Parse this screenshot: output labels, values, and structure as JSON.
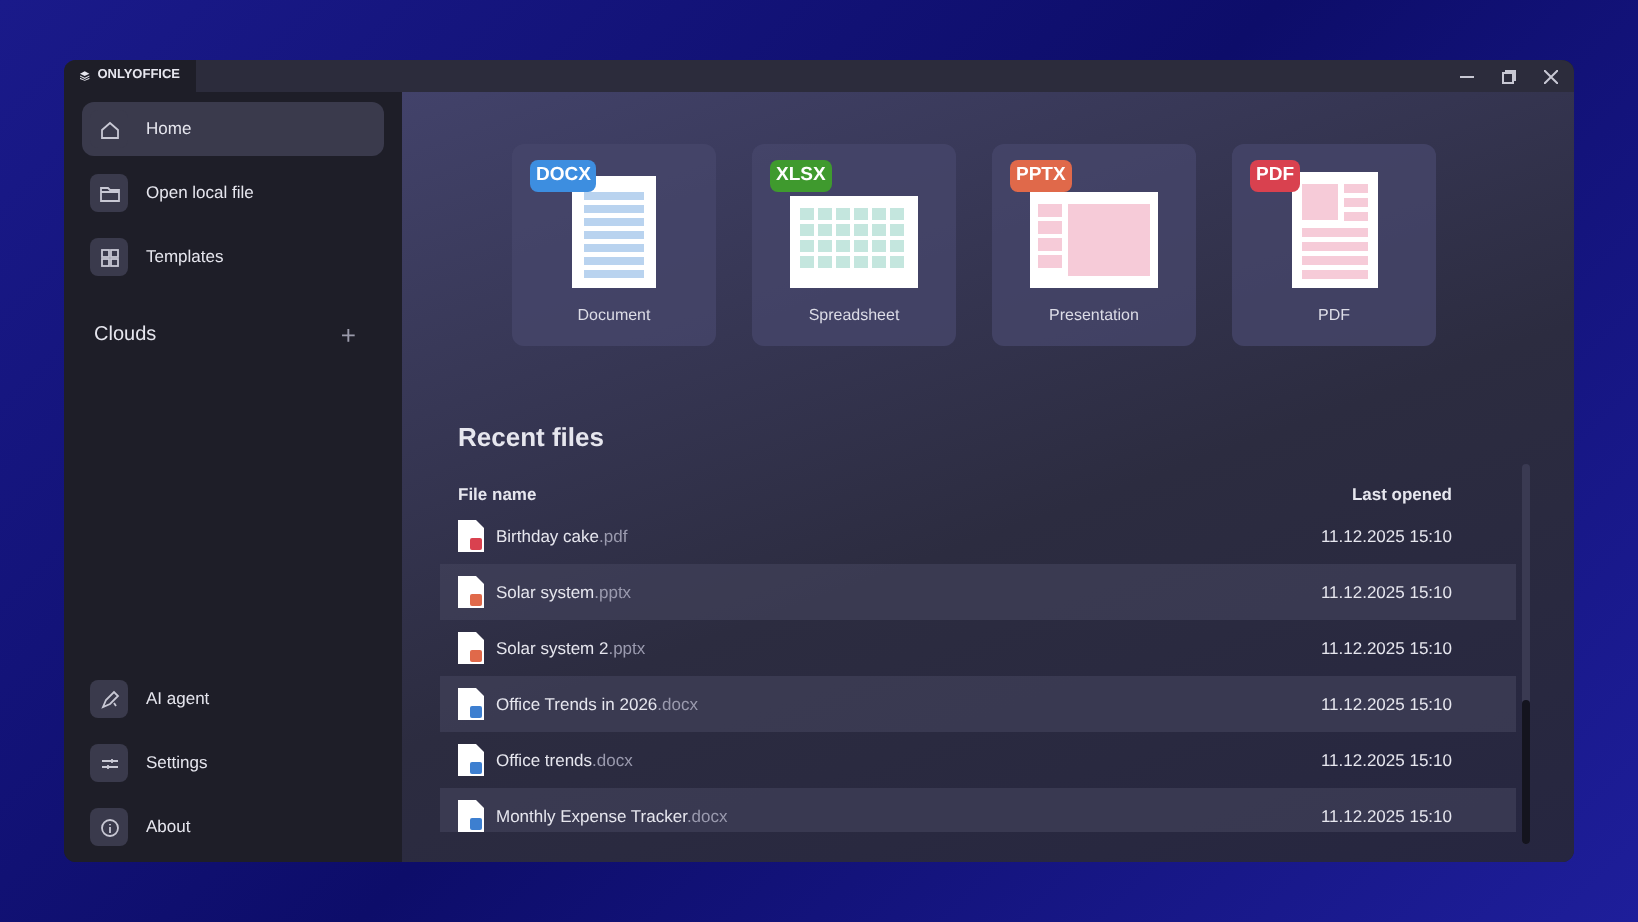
{
  "window": {
    "title": "ONLYOFFICE"
  },
  "sidebar": {
    "items": [
      {
        "label": "Home",
        "selected": true,
        "kind": "home"
      },
      {
        "label": "Open local file",
        "selected": false,
        "kind": "folder"
      },
      {
        "label": "Templates",
        "selected": false,
        "kind": "grid"
      }
    ],
    "clouds": {
      "label": "Clouds",
      "add": "+"
    },
    "bottom_items": [
      {
        "label": "AI agent",
        "kind": "ai"
      },
      {
        "label": "Settings",
        "kind": "settings"
      },
      {
        "label": "About",
        "kind": "info"
      }
    ]
  },
  "create": [
    {
      "kind": "docx",
      "badge": "DOCX",
      "label": "Document"
    },
    {
      "kind": "xlsx",
      "badge": "XLSX",
      "label": "Spreadsheet"
    },
    {
      "kind": "pptx",
      "badge": "PPTX",
      "label": "Presentation"
    },
    {
      "kind": "pdf",
      "badge": "PDF",
      "label": "PDF"
    }
  ],
  "recent": {
    "title": "Recent files",
    "columns": [
      "File name",
      "Last opened"
    ],
    "rows": [
      {
        "kind": "pdf",
        "name": "Birthday cake",
        "ext": ".pdf",
        "opened": "11.12.2025 15:10"
      },
      {
        "kind": "pptx",
        "name": "Solar system",
        "ext": ".pptx",
        "opened": "11.12.2025 15:10"
      },
      {
        "kind": "pptx",
        "name": "Solar system 2",
        "ext": ".pptx",
        "opened": "11.12.2025 15:10"
      },
      {
        "kind": "docx",
        "name": "Office Trends in 2026",
        "ext": ".docx",
        "opened": "11.12.2025 15:10"
      },
      {
        "kind": "docx",
        "name": "Office trends",
        "ext": ".docx",
        "opened": "11.12.2025 15:10"
      },
      {
        "kind": "docx",
        "name": "Monthly Expense Tracker",
        "ext": ".docx",
        "opened": "11.12.2025 15:10"
      }
    ]
  }
}
